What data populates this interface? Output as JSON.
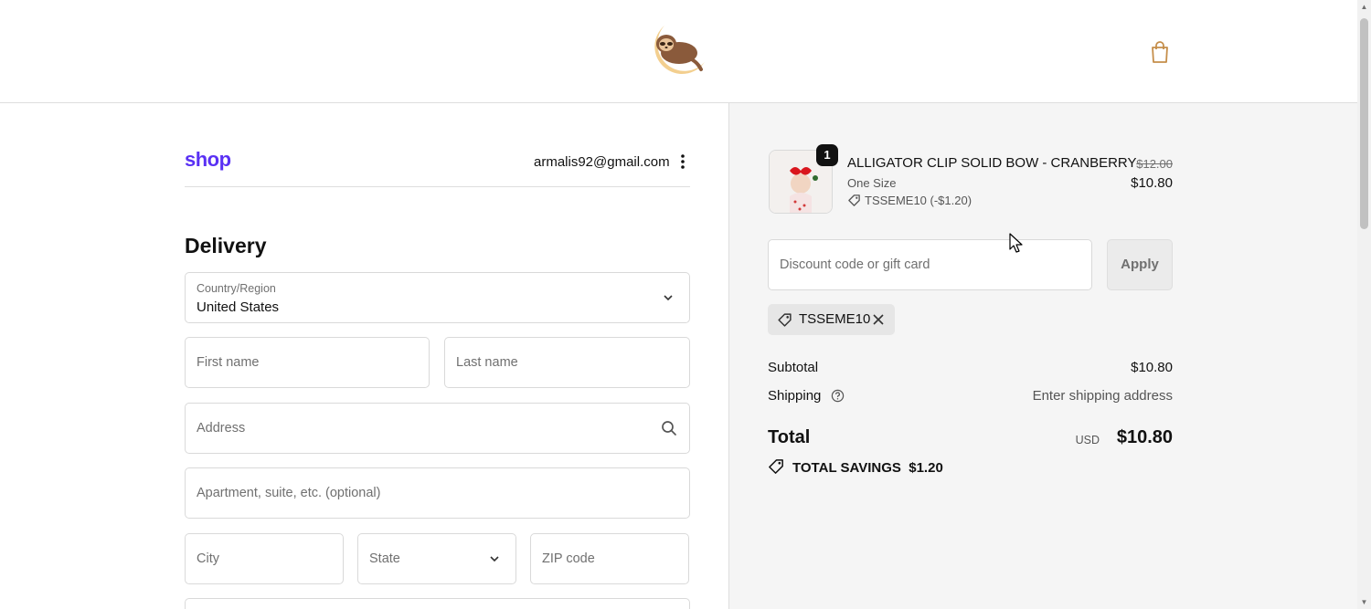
{
  "header": {
    "logo_icon": "sloth-moon-logo",
    "cart_icon": "shopping-bag-icon"
  },
  "account": {
    "shop_brand": "shop",
    "email": "armalis92@gmail.com"
  },
  "delivery": {
    "heading": "Delivery",
    "country_label": "Country/Region",
    "country_value": "United States",
    "first_name_placeholder": "First name",
    "last_name_placeholder": "Last name",
    "address_placeholder": "Address",
    "apartment_placeholder": "Apartment, suite, etc. (optional)",
    "city_placeholder": "City",
    "state_placeholder": "State",
    "zip_placeholder": "ZIP code"
  },
  "cart": {
    "item": {
      "quantity": "1",
      "title": "ALLIGATOR CLIP SOLID BOW - CRANBERRY",
      "variant": "One Size",
      "discount": "TSSEME10 (-$1.20)",
      "original_price": "$12.00",
      "price": "$10.80"
    },
    "discount_placeholder": "Discount code or gift card",
    "apply_label": "Apply",
    "applied_code": "TSSEME10",
    "subtotal_label": "Subtotal",
    "subtotal_value": "$10.80",
    "shipping_label": "Shipping",
    "shipping_value": "Enter shipping address",
    "total_label": "Total",
    "currency": "USD",
    "total_value": "$10.80",
    "savings_label": "TOTAL SAVINGS",
    "savings_value": "$1.20"
  },
  "colors": {
    "shop_brand": "#5a31f4",
    "panel_bg": "#f5f5f5",
    "logo_tan": "#f0c98a"
  }
}
